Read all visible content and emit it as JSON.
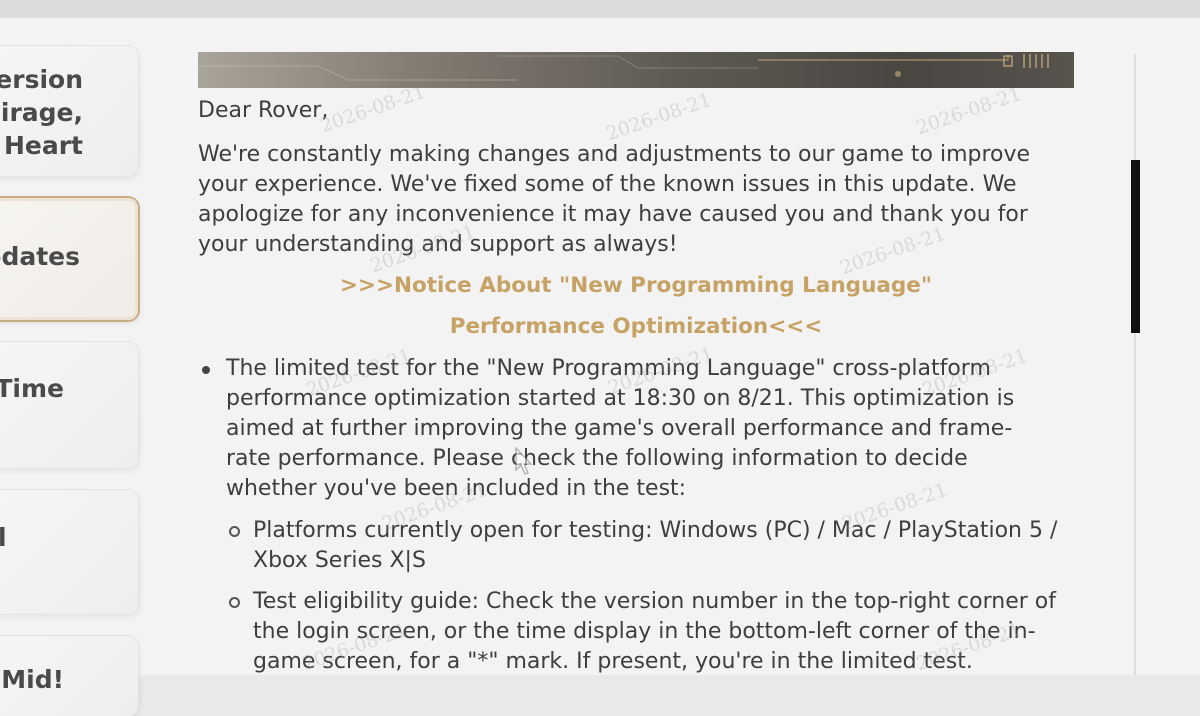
{
  "sidebar": {
    "tabs": [
      {
        "label": "ersion\nMirage,\nn Heart"
      },
      {
        "label": "pdates"
      },
      {
        "label": "l-Time"
      },
      {
        "label": "l"
      },
      {
        "label": "Mid!"
      }
    ]
  },
  "notice": {
    "greeting": "Dear Rover,",
    "intro": "We're constantly making changes and adjustments to our game to improve your experience. We've fixed some of the known issues in this update. We apologize for any inconvenience it may have caused you and thank you for your understanding and support as always!",
    "heading_line1": ">>>Notice About \"New Programming Language\"",
    "heading_line2": "Performance Optimization<<<",
    "bullet1": "The limited test for the \"New Programming Language\" cross-platform performance optimization started at 18:30 on 8/21. This optimization is aimed at further improving the game's overall performance and frame-rate performance. Please check the following information to decide whether you've been included in the test:",
    "sub1": "Platforms currently open for testing: Windows (PC) / Mac / PlayStation 5 / Xbox Series X|S",
    "sub2": "Test eligibility guide: Check the version number in the top-right corner of the login screen, or the time display in the bottom-left corner of the in-game screen, for a \"*\" mark. If present, you're in the limited test."
  },
  "watermark": "2026-08-21"
}
